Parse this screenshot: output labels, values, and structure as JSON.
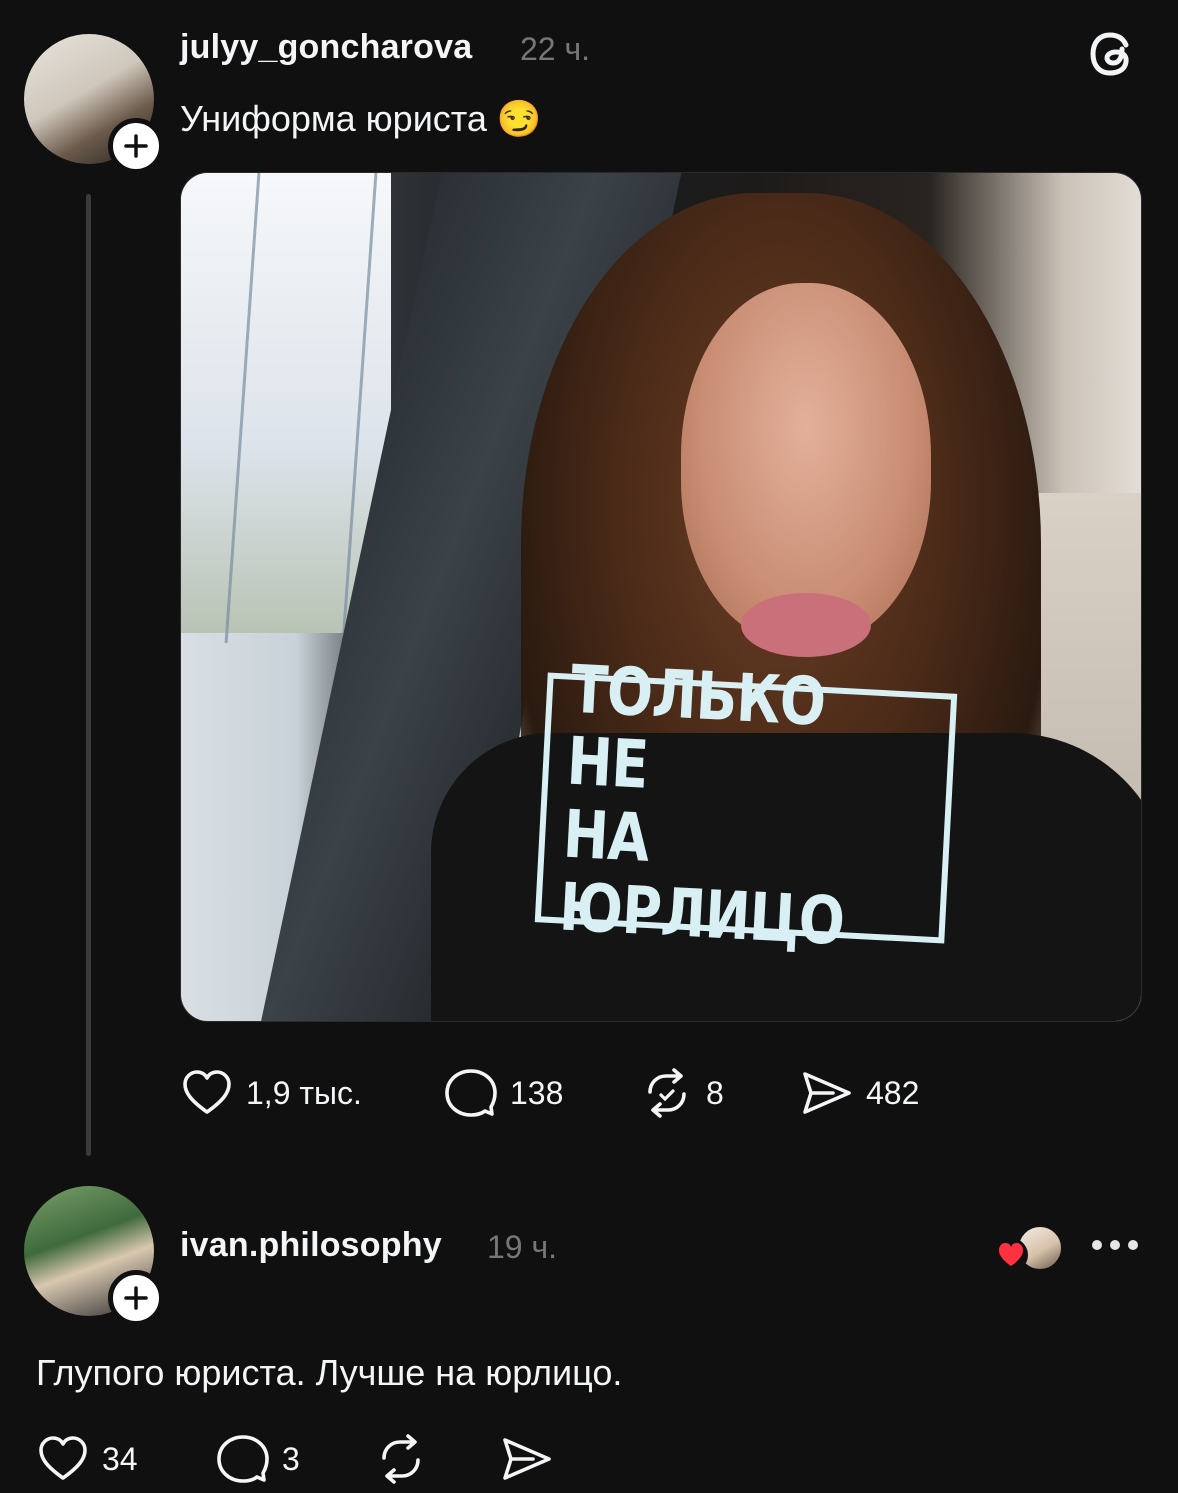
{
  "post": {
    "username": "julyy_goncharova",
    "time": "22 ч.",
    "text": "Униформа юриста 😏",
    "image_shirt_text": [
      "ТОЛЬКО НЕ",
      "НА ЮРЛИЦО"
    ],
    "actions": {
      "likes": "1,9 тыс.",
      "comments": "138",
      "reposts": "8",
      "shares": "482"
    }
  },
  "reply": {
    "username": "ivan.philosophy",
    "time": "19 ч.",
    "text": "Глупого юриста. Лучше на юрлицо.",
    "actions": {
      "likes": "34",
      "comments": "3"
    }
  },
  "colors": {
    "background": "#101010",
    "text": "#f3f5f7",
    "muted": "#777777",
    "like_red": "#ff3040"
  },
  "icons": [
    "threads-logo-icon",
    "plus-icon",
    "heart-icon",
    "comment-icon",
    "repost-icon",
    "share-icon",
    "more-icon"
  ]
}
